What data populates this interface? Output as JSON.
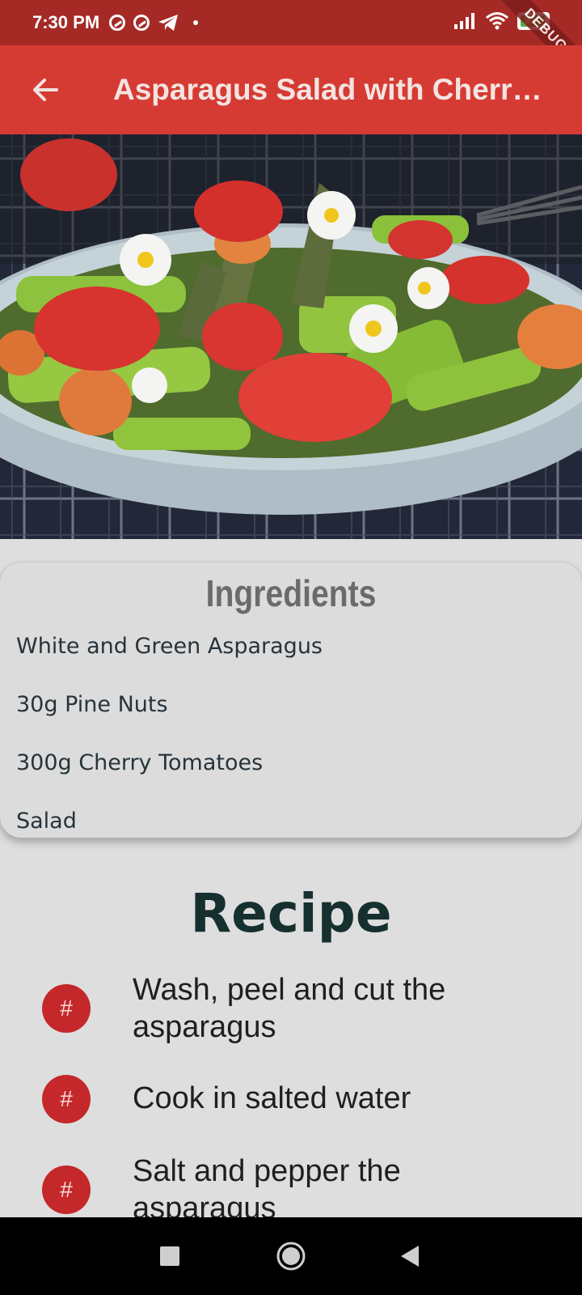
{
  "status_bar": {
    "time": "7:30 PM",
    "battery": "91",
    "debug_label": "DEBUG"
  },
  "app_bar": {
    "title": "Asparagus Salad with Cherry...",
    "back_icon": "arrow-back-icon"
  },
  "hero": {
    "description_icon": "salad-photo"
  },
  "ingredients": {
    "title": "Ingredients",
    "items": [
      "White and Green Asparagus",
      "30g Pine Nuts",
      "300g Cherry Tomatoes",
      "Salad"
    ]
  },
  "recipe": {
    "title": "Recipe",
    "steps": [
      {
        "badge": "#",
        "text": "Wash, peel and cut the asparagus"
      },
      {
        "badge": "#",
        "text": "Cook in salted water"
      },
      {
        "badge": "#",
        "text": "Salt and pepper the asparagus"
      }
    ]
  },
  "colors": {
    "status_bar": "#a52a26",
    "app_bar": "#d63b33",
    "badge": "#c5282a",
    "background": "#dedede"
  }
}
